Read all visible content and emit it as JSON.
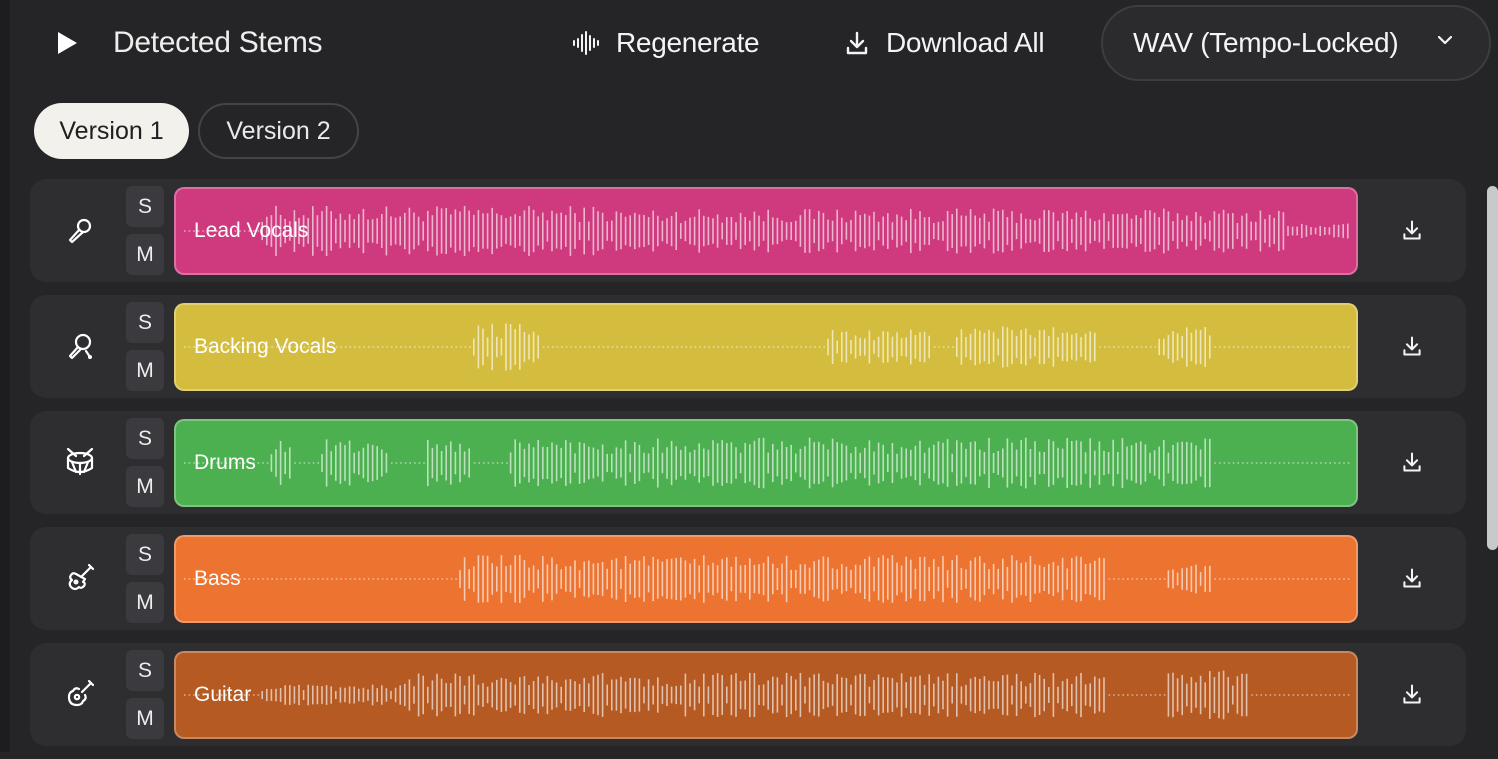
{
  "header": {
    "title": "Detected Stems",
    "regenerate_label": "Regenerate",
    "download_all_label": "Download All",
    "format_selected": "WAV (Tempo-Locked)"
  },
  "tabs": [
    {
      "label": "Version 1",
      "active": true
    },
    {
      "label": "Version 2",
      "active": false
    }
  ],
  "stems": [
    {
      "name": "Lead Vocals",
      "icon": "microphone-icon",
      "color": "#cf3a7f",
      "solo_label": "S",
      "mute_label": "M",
      "activity": [
        [
          0.07,
          0.36,
          0.85
        ],
        [
          0.36,
          0.94,
          0.75
        ],
        [
          0.94,
          1.0,
          0.25
        ]
      ]
    },
    {
      "name": "Backing Vocals",
      "icon": "microphone-alt-icon",
      "color": "#d4bd3e",
      "solo_label": "S",
      "mute_label": "M",
      "activity": [
        [
          0.25,
          0.31,
          0.8
        ],
        [
          0.55,
          0.64,
          0.6
        ],
        [
          0.66,
          0.78,
          0.7
        ],
        [
          0.83,
          0.88,
          0.7
        ]
      ]
    },
    {
      "name": "Drums",
      "icon": "drum-icon",
      "color": "#4cb050",
      "solo_label": "S",
      "mute_label": "M",
      "activity": [
        [
          0.08,
          0.1,
          0.8
        ],
        [
          0.12,
          0.18,
          0.8
        ],
        [
          0.21,
          0.25,
          0.8
        ],
        [
          0.28,
          0.88,
          0.85
        ]
      ]
    },
    {
      "name": "Bass",
      "icon": "electric-guitar-icon",
      "color": "#ec7330",
      "solo_label": "S",
      "mute_label": "M",
      "activity": [
        [
          0.24,
          0.79,
          0.8
        ],
        [
          0.84,
          0.88,
          0.55
        ]
      ]
    },
    {
      "name": "Guitar",
      "icon": "acoustic-guitar-icon",
      "color": "#b55a22",
      "solo_label": "S",
      "mute_label": "M",
      "activity": [
        [
          0.07,
          0.19,
          0.35
        ],
        [
          0.19,
          0.79,
          0.75
        ],
        [
          0.84,
          0.91,
          0.85
        ]
      ]
    }
  ]
}
